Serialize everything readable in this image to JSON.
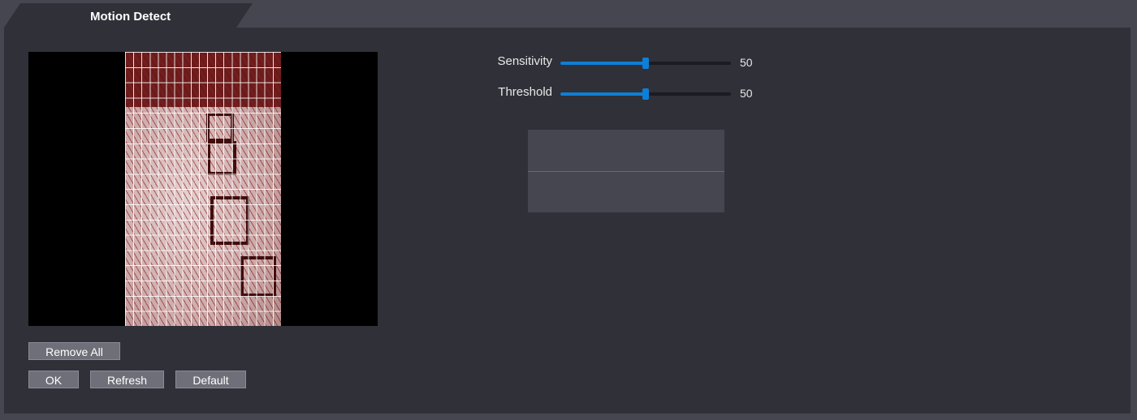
{
  "tab": {
    "title": "Motion Detect"
  },
  "sliders": [
    {
      "label": "Sensitivity",
      "value": 50,
      "min": 0,
      "max": 100,
      "value_text": "50"
    },
    {
      "label": "Threshold",
      "value": 50,
      "min": 0,
      "max": 100,
      "value_text": "50"
    }
  ],
  "buttons": {
    "remove_all": "Remove All",
    "ok": "OK",
    "refresh": "Refresh",
    "default": "Default"
  },
  "colors": {
    "accent": "#0e7fd6",
    "panel": "#2f3038",
    "background": "#45464f",
    "button": "#6e6f78",
    "region_overlay": "#c8a9a9"
  }
}
